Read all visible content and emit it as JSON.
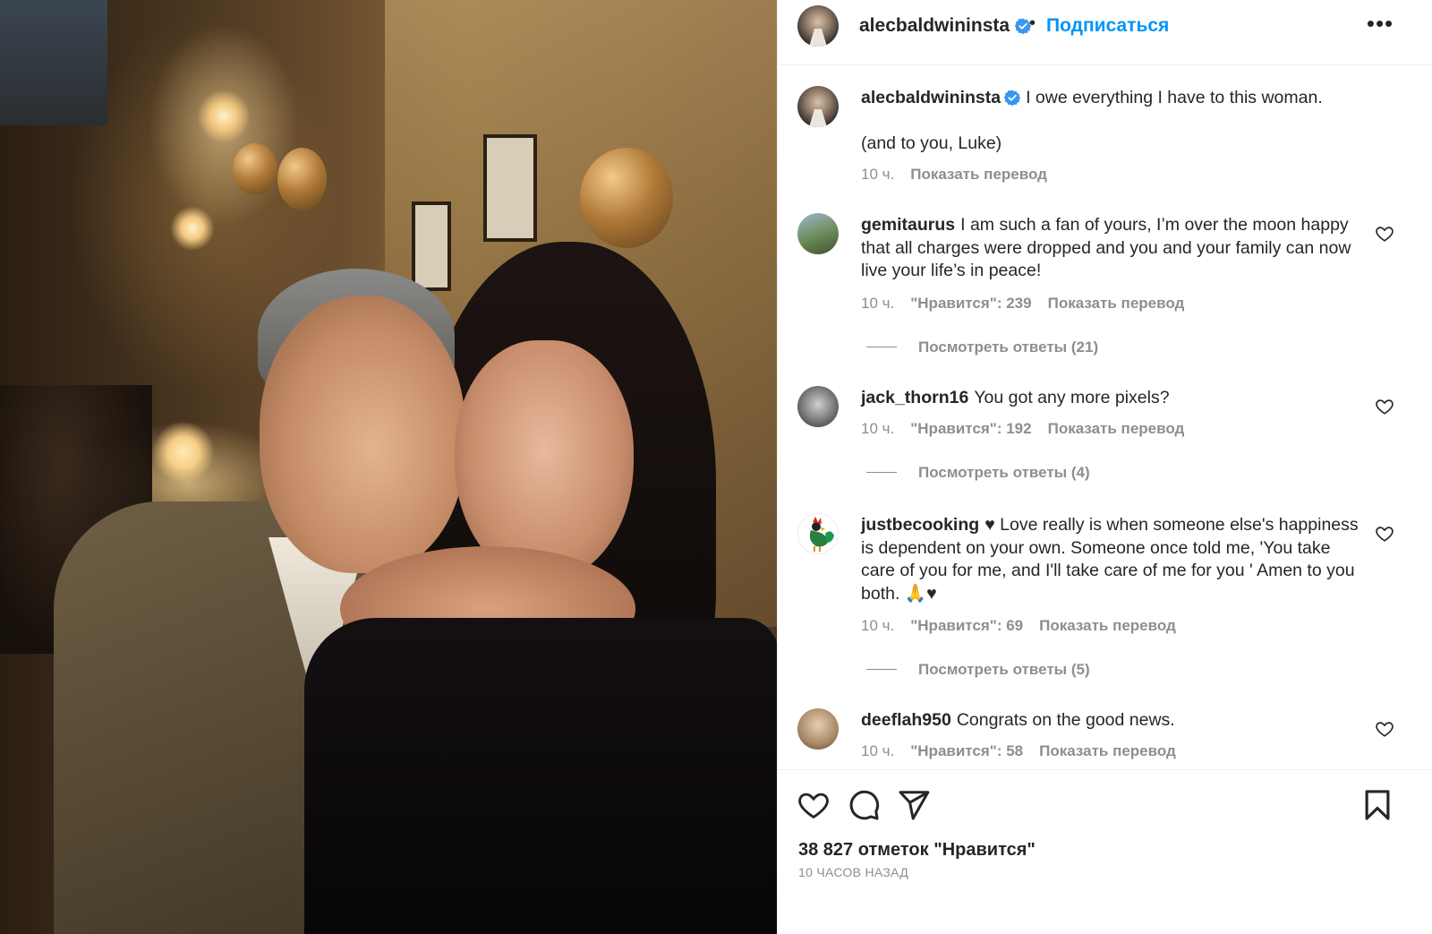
{
  "post": {
    "username": "alecbaldwininsta",
    "verified": true,
    "separator": "•",
    "follow_label": "Подписаться",
    "more_label": "•••",
    "photo_alt": "alecbaldwininsta"
  },
  "caption": {
    "username": "alecbaldwininsta",
    "line1": "I owe everything I have to this woman.",
    "line2": "(and to you, Luke)",
    "time": "10 ч.",
    "translate": "Показать перевод"
  },
  "comments": [
    {
      "username": "gemitaurus",
      "text": "I am such a fan of yours, I’m over the moon happy that all charges were dropped and you and your family can now live your life’s in peace!",
      "time": "10 ч.",
      "likes": "\"Нравится\": 239",
      "translate": "Показать перевод",
      "replies": "Посмотреть ответы (21)"
    },
    {
      "username": "jack_thorn16",
      "text": "You got any more pixels?",
      "time": "10 ч.",
      "likes": "\"Нравится\": 192",
      "translate": "Показать перевод",
      "replies": "Посмотреть ответы (4)"
    },
    {
      "username": "justbecooking",
      "text": "♥ Love really is when someone else's happiness is dependent on your own. Someone once told me, 'You take care of you for me, and I'll take care of me for you ' Amen to you both. 🙏♥",
      "time": "10 ч.",
      "likes": "\"Нравится\": 69",
      "translate": "Показать перевод",
      "replies": "Посмотреть ответы (5)"
    },
    {
      "username": "deeflah950",
      "text": "Congrats on the good news.",
      "time": "10 ч.",
      "likes": "\"Нравится\": 58",
      "translate": "Показать перевод"
    }
  ],
  "footer": {
    "likes_count": "38 827 отметок \"Нравится\"",
    "posted_ago": "10 ЧАСОВ НАЗАД"
  },
  "colors": {
    "accent": "#0095f6",
    "muted": "#8e8e8e",
    "text": "#262626",
    "verified": "#3897f0"
  },
  "icons": {
    "like": "heart-icon",
    "comment": "comment-icon",
    "share": "paper-plane-icon",
    "save": "bookmark-icon",
    "more": "more-dots-icon",
    "verified": "verified-badge-icon"
  }
}
